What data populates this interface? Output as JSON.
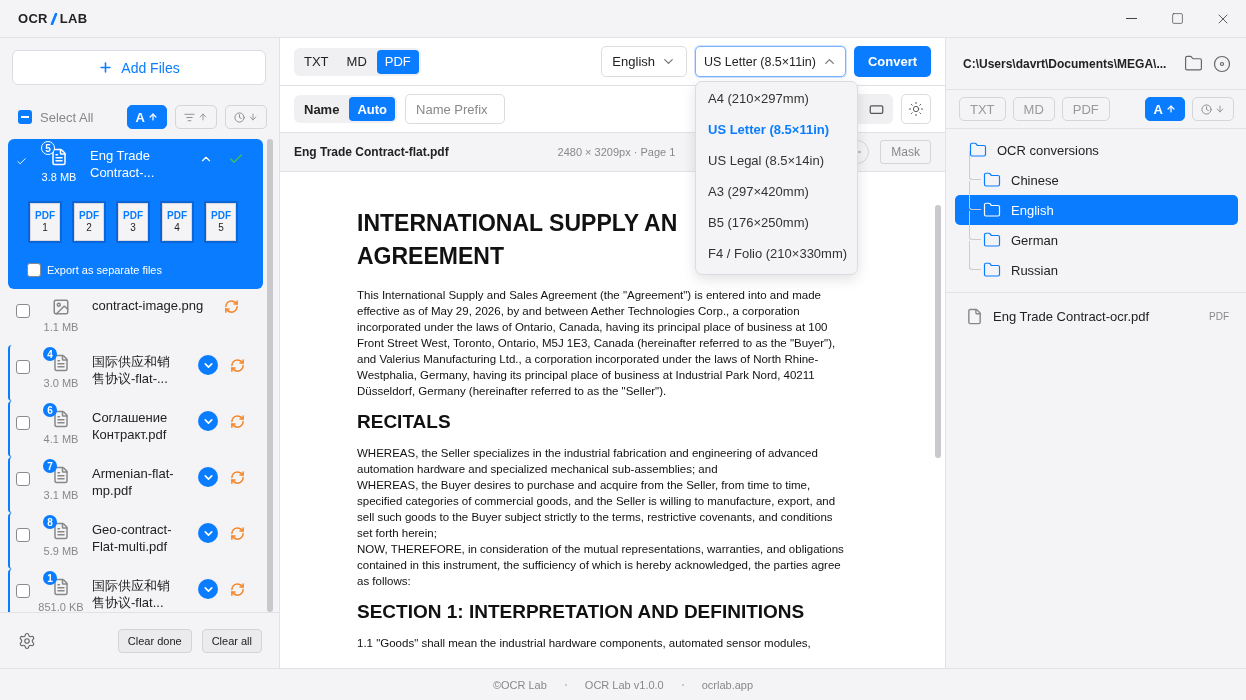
{
  "window": {
    "logo": {
      "left": "OCR",
      "right": "LAB"
    }
  },
  "sidebar": {
    "add_button": "Add Files",
    "select_all": {
      "label": "Select All",
      "indeterminate": true
    },
    "sort_buttons": [
      {
        "kind": "name",
        "label": "A",
        "selected": true
      },
      {
        "kind": "size",
        "selected": false
      },
      {
        "kind": "time",
        "selected": false
      }
    ],
    "files": [
      {
        "kind": "group",
        "badge": "5",
        "name": "Eng Trade Contract-...",
        "size": "3.8 MB",
        "selected": true,
        "checked": true,
        "expanded": true,
        "done": true,
        "pages": [
          {
            "label": "PDF",
            "number": "1"
          },
          {
            "label": "PDF",
            "number": "2"
          },
          {
            "label": "PDF",
            "number": "3"
          },
          {
            "label": "PDF",
            "number": "4"
          },
          {
            "label": "PDF",
            "number": "5"
          }
        ],
        "export_separate": {
          "label": "Export as separate files",
          "checked": false
        }
      },
      {
        "kind": "single",
        "name": "contract-image.png",
        "size": "1.1 MB",
        "selected": false,
        "checked": false,
        "done": false
      },
      {
        "kind": "group",
        "badge": "4",
        "name": "国际供应和销售协议-flat-...",
        "size": "3.0 MB",
        "selected": false,
        "checked": false,
        "expanded": false,
        "done": false
      },
      {
        "kind": "group",
        "badge": "6",
        "name": "Соглашение Контракт.pdf",
        "size": "4.1 MB",
        "selected": false,
        "checked": false,
        "expanded": false,
        "done": false
      },
      {
        "kind": "group",
        "badge": "7",
        "name": "Armenian-flat-mp.pdf",
        "size": "3.1 MB",
        "selected": false,
        "checked": false,
        "expanded": false,
        "done": false
      },
      {
        "kind": "group",
        "badge": "8",
        "name": "Geo-contract-Flat-multi.pdf",
        "size": "5.9 MB",
        "selected": false,
        "checked": false,
        "expanded": false,
        "done": false
      },
      {
        "kind": "group",
        "badge": "1",
        "name": "国际供应和销售协议-flat...",
        "size": "851.0 KB",
        "selected": false,
        "checked": false,
        "expanded": false,
        "done": false
      }
    ],
    "footer_buttons": [
      "Clear done",
      "Clear all"
    ]
  },
  "toolbar": {
    "formats": [
      {
        "label": "TXT",
        "selected": false
      },
      {
        "label": "MD",
        "selected": false
      },
      {
        "label": "PDF",
        "selected": true
      }
    ],
    "language": "English",
    "paper": {
      "value": "US Letter (8.5×11in)",
      "expanded": true,
      "options": [
        {
          "label": "A4 (210×297mm)",
          "selected": false
        },
        {
          "label": "US Letter (8.5×11in)",
          "selected": true
        },
        {
          "label": "US Legal (8.5×14in)",
          "selected": false
        },
        {
          "label": "A3 (297×420mm)",
          "selected": false
        },
        {
          "label": "B5 (176×250mm)",
          "selected": false
        },
        {
          "label": "F4 / Folio (210×330mm)",
          "selected": false
        }
      ]
    },
    "convert": "Convert"
  },
  "naming": {
    "modes": [
      {
        "label": "Name",
        "selected": false
      },
      {
        "label": "Auto",
        "selected": true
      }
    ],
    "prefix_placeholder": "Name Prefix"
  },
  "document": {
    "filename": "Eng Trade Contract-flat.pdf",
    "meta": "2480 × 3209px · Page 1",
    "mask": "Mask",
    "blocks": [
      {
        "kind": "title",
        "lines": [
          "INTERNATIONAL SUPPLY AN",
          "AGREEMENT"
        ]
      },
      {
        "kind": "paragraph",
        "lines": [
          "This International Supply and Sales Agreement (the \"Agreement\") is entered into and made",
          "effective as of May 29, 2026, by and between Aether Technologies Corp., a corporation",
          "incorporated under the laws of Ontario, Canada, having its principal place of business at 100",
          "Front Street West, Toronto, Ontario, M5J 1E3, Canada (hereinafter referred to as the \"Buyer\"),",
          "and Valerius Manufacturing Ltd., a corporation incorporated under the laws of North Rhine-",
          "Westphalia, Germany, having its principal place of business at Industrial Park Nord, 40211",
          "Düsseldorf, Germany (hereinafter referred to as the \"Seller\")."
        ]
      },
      {
        "kind": "heading",
        "lines": [
          "RECITALS"
        ]
      },
      {
        "kind": "paragraph",
        "lines": [
          "WHEREAS, the Seller specializes in the industrial fabrication and engineering of advanced",
          "automation hardware and specialized mechanical sub-assemblies; and",
          "WHEREAS, the Buyer desires to purchase and acquire from the Seller, from time to time,",
          "specified categories of commercial goods, and the Seller is willing to manufacture, export, and",
          "sell such goods to the Buyer subject strictly to the terms, restrictive covenants, and conditions",
          "set forth herein;",
          "NOW, THEREFORE, in consideration of the mutual representations, warranties, and obligations",
          "contained in this instrument, the sufficiency of which is hereby acknowledged, the parties agree",
          "as follows:"
        ]
      },
      {
        "kind": "heading",
        "lines": [
          "SECTION 1: INTERPRETATION AND DEFINITIONS"
        ]
      },
      {
        "kind": "paragraph",
        "lines": [
          "1.1 \"Goods\" shall mean the industrial hardware components, automated sensor modules,"
        ]
      }
    ]
  },
  "output": {
    "path": "C:\\Users\\davrt\\Documents\\MEGA\\...",
    "filters": [
      {
        "label": "TXT",
        "selected": false
      },
      {
        "label": "MD",
        "selected": false
      },
      {
        "label": "PDF",
        "selected": false
      }
    ],
    "sort_buttons": [
      {
        "kind": "name",
        "label": "A",
        "selected": true
      },
      {
        "kind": "time",
        "selected": false
      }
    ],
    "tree": [
      {
        "name": "OCR conversions",
        "selected": false,
        "children": [
          {
            "name": "Chinese",
            "selected": false
          },
          {
            "name": "English",
            "selected": true
          },
          {
            "name": "German",
            "selected": false
          },
          {
            "name": "Russian",
            "selected": false
          }
        ]
      }
    ],
    "files": [
      {
        "name": "Eng Trade Contract-ocr.pdf",
        "type": "PDF"
      }
    ]
  },
  "status_bar": [
    "©OCR Lab",
    "OCR Lab v1.0.0",
    "ocrlab.app"
  ]
}
